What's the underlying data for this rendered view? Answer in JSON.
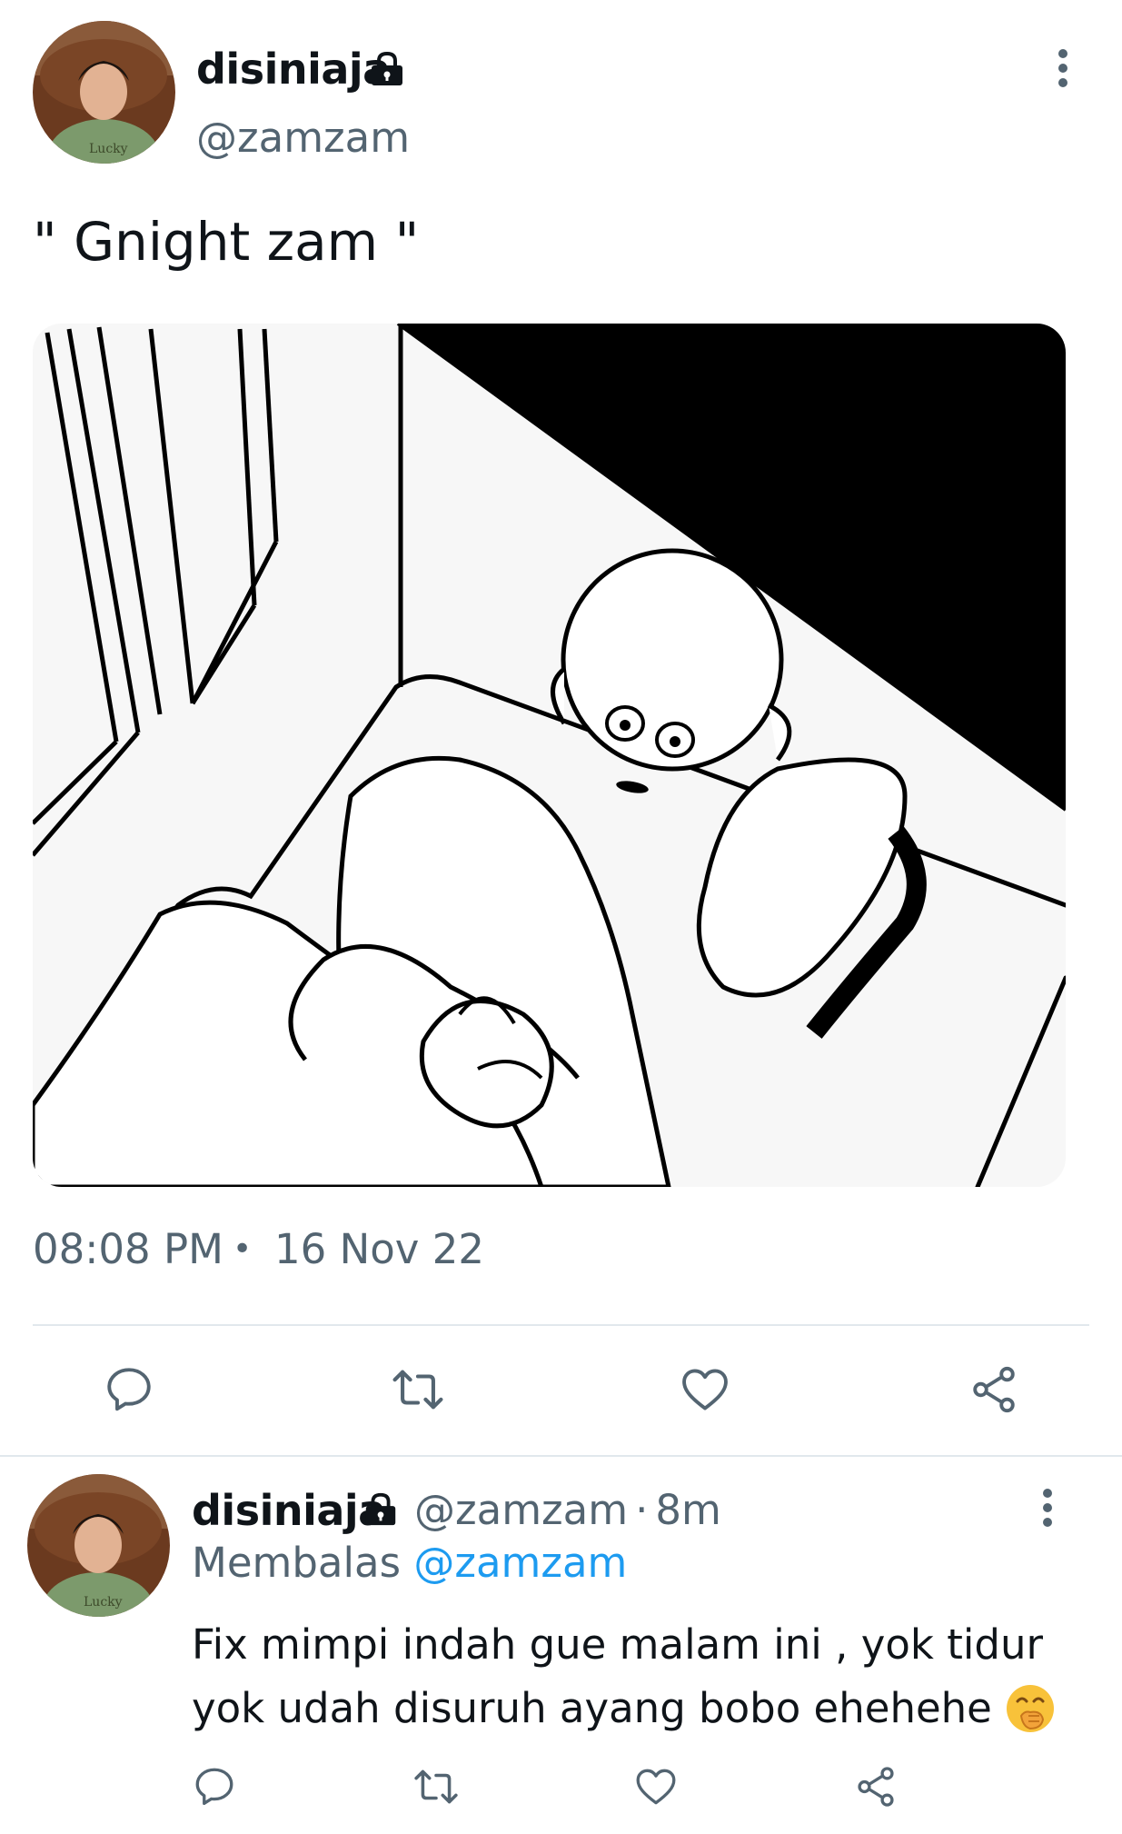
{
  "tweet": {
    "author_name": "disiniaja",
    "handle": "@zamzam",
    "text": "\" Gnight zam \"",
    "time": "08:08 PM",
    "separator": "•",
    "date": "16 Nov 22"
  },
  "reply": {
    "author_name": "disiniaja",
    "handle": "@zamzam",
    "dot": "·",
    "age": "8m",
    "replying_label": "Membalas",
    "replying_to": "@zamzam",
    "text_line1": "Fix mimpi indah gue malam ini , yok tidur",
    "text_line2": "yok udah disuruh ayang bobo ehehehe",
    "emoji": "face-with-hand-over-mouth"
  },
  "icons": {
    "lock": "lock-icon",
    "more": "more-vertical-icon",
    "reply": "comment-icon",
    "retweet": "retweet-icon",
    "like": "heart-icon",
    "share": "share-icon"
  },
  "colors": {
    "text": "#0f1419",
    "muted": "#536471",
    "link": "#1d9bf0",
    "divider": "#e1e8ed"
  }
}
